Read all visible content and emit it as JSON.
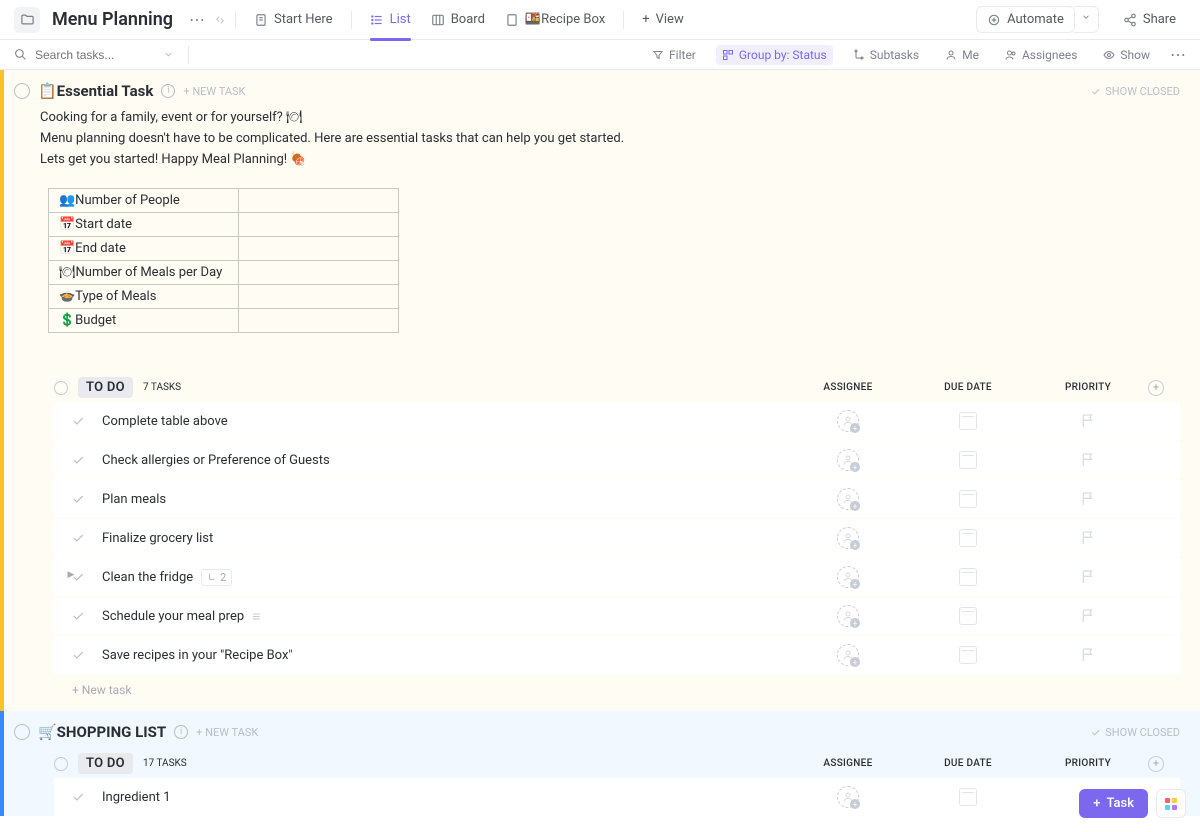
{
  "header": {
    "title": "Menu Planning",
    "tabs": [
      {
        "icon": "doc",
        "label": "Start Here"
      },
      {
        "icon": "list",
        "label": "List"
      },
      {
        "icon": "board",
        "label": "Board"
      },
      {
        "icon": "doc",
        "label": "🍱Recipe Box"
      },
      {
        "icon": "plus",
        "label": "View"
      }
    ],
    "automate": "Automate",
    "share": "Share"
  },
  "toolbar": {
    "search_placeholder": "Search tasks...",
    "filter": "Filter",
    "group_by": "Group by: Status",
    "subtasks": "Subtasks",
    "me": "Me",
    "assignees": "Assignees",
    "show": "Show"
  },
  "sections": [
    {
      "color": "yellow",
      "title": "📋Essential Task",
      "new_task": "+ NEW TASK",
      "show_closed": "SHOW CLOSED",
      "description": [
        "Cooking for a family, event or for yourself? 🍽",
        "Menu planning doesn't have to be complicated. Here are essential tasks that can help you get started.",
        "Lets get you started! Happy Meal Planning! 🍖"
      ],
      "plan_rows": [
        "👥Number of People",
        "📅Start date",
        "📅End date",
        "🍽Number of Meals per Day",
        "🍲Type of Meals",
        "💲Budget"
      ],
      "status_groups": [
        {
          "label": "TO DO",
          "count": "7 TASKS",
          "columns": {
            "assignee": "ASSIGNEE",
            "due": "DUE DATE",
            "priority": "PRIORITY"
          },
          "tasks": [
            {
              "name": "Complete table above"
            },
            {
              "name": "Check allergies or Preference of Guests"
            },
            {
              "name": "Plan meals"
            },
            {
              "name": "Finalize grocery list"
            },
            {
              "name": "Clean the fridge",
              "subtasks": "2",
              "expandable": true
            },
            {
              "name": "Schedule your meal prep",
              "menu": true
            },
            {
              "name": "Save recipes in your \"Recipe Box\""
            }
          ],
          "new_task": "+ New task"
        }
      ]
    },
    {
      "color": "blue",
      "title": "🛒SHOPPING LIST",
      "new_task": "+ NEW TASK",
      "show_closed": "SHOW CLOSED",
      "status_groups": [
        {
          "label": "TO DO",
          "count": "17 TASKS",
          "columns": {
            "assignee": "ASSIGNEE",
            "due": "DUE DATE",
            "priority": "PRIORITY"
          },
          "tasks": [
            {
              "name": "Ingredient 1"
            }
          ]
        }
      ]
    }
  ],
  "fab": {
    "task": "Task"
  },
  "grid_colors": [
    "#ff5e5e",
    "#ffce3a",
    "#5ecfff",
    "#b278ff"
  ]
}
